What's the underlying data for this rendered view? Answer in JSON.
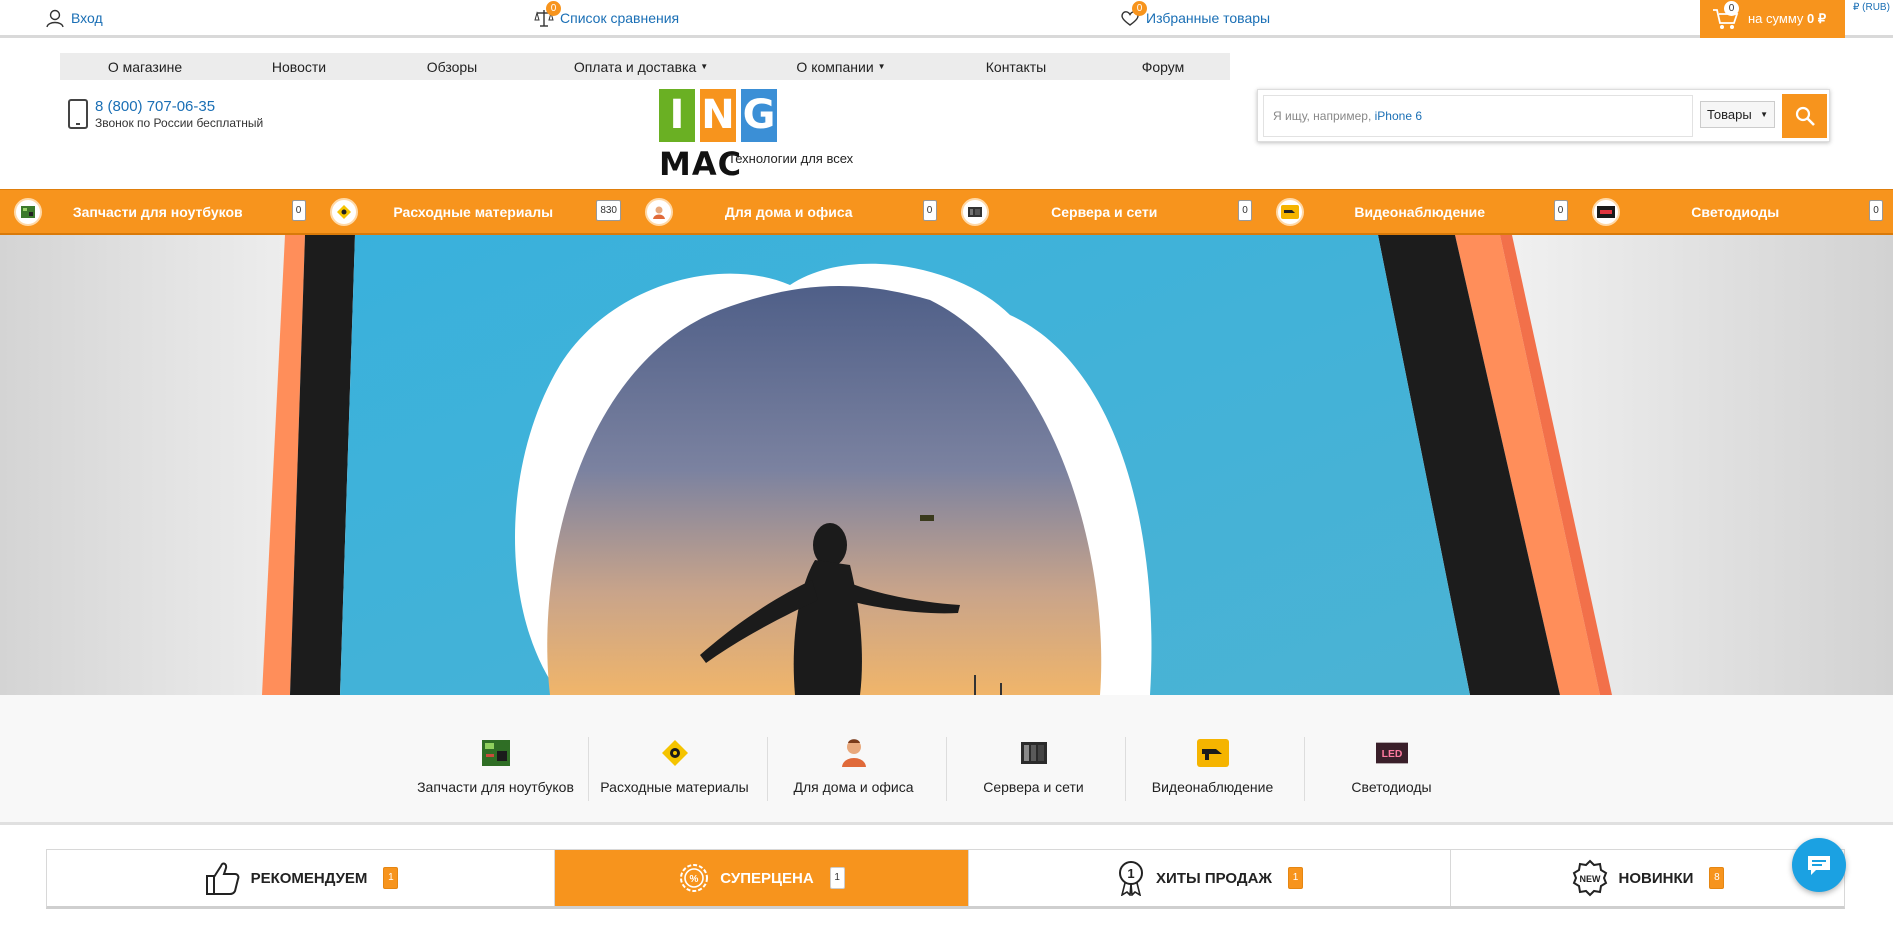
{
  "topbar": {
    "login": "Вход",
    "compare": "Список сравнения",
    "compare_count": "0",
    "favorites": "Избранные товары",
    "favorites_count": "0",
    "cart_count": "0",
    "cart_prefix": "на сумму",
    "cart_sum": "0 ₽",
    "currency": "₽ (RUB)"
  },
  "nav": {
    "items": [
      {
        "label": "О магазине"
      },
      {
        "label": "Новости"
      },
      {
        "label": "Обзоры"
      },
      {
        "label": "Оплата и доставка",
        "dropdown": true
      },
      {
        "label": "О компании",
        "dropdown": true
      },
      {
        "label": "Контакты"
      },
      {
        "label": "Форум"
      }
    ]
  },
  "contact": {
    "phone": "8 (800) 707-06-35",
    "note": "Звонок по России бесплатный"
  },
  "logo": {
    "letters": [
      "I",
      "N",
      "G"
    ],
    "colors": [
      "#6ab023",
      "#f7941d",
      "#3b8fd6"
    ],
    "mac": "MAC",
    "tagline": "Технологии для всех"
  },
  "search": {
    "placeholder": "Я ищу, например,",
    "hint": "iPhone 6",
    "scope": "Товары"
  },
  "categories": [
    {
      "label": "Запчасти для ноутбуков",
      "count": "0",
      "icon": "laptop-board-icon"
    },
    {
      "label": "Расходные материалы",
      "count": "830",
      "icon": "consumables-icon"
    },
    {
      "label": "Для дома и офиса",
      "count": "0",
      "icon": "home-office-icon"
    },
    {
      "label": "Сервера и сети",
      "count": "0",
      "icon": "server-icon"
    },
    {
      "label": "Видеонаблюдение",
      "count": "0",
      "icon": "cctv-camera-icon"
    },
    {
      "label": "Светодиоды",
      "count": "0",
      "icon": "led-icon"
    }
  ],
  "tiles": {
    "led_text": "LED"
  },
  "tabs": [
    {
      "label": "РЕКОМЕНДУЕМ",
      "count": "1",
      "icon": "thumbs-up-icon",
      "active": false
    },
    {
      "label": "СУПЕРЦЕНА",
      "count": "1",
      "icon": "percent-badge-icon",
      "active": true
    },
    {
      "label": "ХИТЫ ПРОДАЖ",
      "count": "1",
      "icon": "award-medal-icon",
      "active": false
    },
    {
      "label": "НОВИНКИ",
      "count": "8",
      "icon": "new-badge-icon",
      "active": false
    }
  ],
  "colors": {
    "accent": "#f7941d",
    "link": "#1a6fb5",
    "hero_sky": "#3ab0d8",
    "chat": "#1ba1e2"
  }
}
